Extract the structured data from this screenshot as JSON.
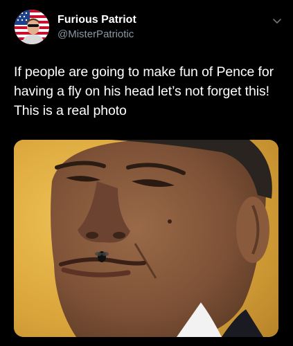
{
  "tweet": {
    "author": {
      "display_name": "Furious Patriot",
      "handle": "@MisterPatriotic",
      "avatar_icon": "american-flag-avatar"
    },
    "menu_icon": "chevron-down-icon",
    "text": "If people are going to make fun of Pence for having a fly on his head let’s not forget this! This is a real photo",
    "media": {
      "type": "photo"
    }
  },
  "colors": {
    "background": "#000000",
    "text_primary": "#ffffff",
    "text_secondary": "#8b98a5",
    "photo_background": "#d8a83a"
  }
}
